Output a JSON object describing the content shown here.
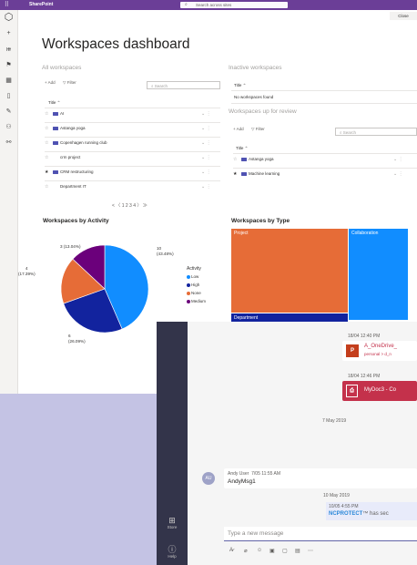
{
  "sharepoint": {
    "app_name": "SharePoint",
    "search_placeholder": "Search across sites",
    "close_label": "Close",
    "page_title": "Workspaces dashboard",
    "all_workspaces": {
      "title": "All workspaces",
      "add_label": "+ Add",
      "filter_label": "Filter",
      "search_placeholder": "Search",
      "column_title": "Title",
      "rows": [
        {
          "name": "AI",
          "starred": false,
          "icon": true
        },
        {
          "name": "Astanga yoga",
          "starred": false,
          "icon": true
        },
        {
          "name": "Copenhagen running club",
          "starred": false,
          "icon": true
        },
        {
          "name": "crm project",
          "starred": false,
          "icon": false
        },
        {
          "name": "CRM restructuring",
          "starred": true,
          "icon": true
        },
        {
          "name": "Department IT",
          "starred": false,
          "icon": false
        }
      ],
      "pager": "< 〈 1  2  3  4  〉 ≫"
    },
    "inactive_workspaces": {
      "title": "Inactive workspaces",
      "column_title": "Title",
      "empty_text": "No workspaces found"
    },
    "review_workspaces": {
      "title": "Workspaces up for review",
      "add_label": "+ Add",
      "filter_label": "Filter",
      "search_placeholder": "Search",
      "column_title": "Title",
      "rows": [
        {
          "name": "Astanga yoga",
          "starred": false
        },
        {
          "name": "Machine learning",
          "starred": true
        }
      ]
    },
    "activity_chart_title": "Workspaces by Activity",
    "type_chart_title": "Workspaces by Type",
    "legend_title": "Activity"
  },
  "chart_data": [
    {
      "type": "pie",
      "title": "Workspaces by Activity",
      "legend_title": "Activity",
      "legend_placement": "right",
      "categories": [
        "Low",
        "High",
        "None",
        "Medium"
      ],
      "values": [
        10,
        6,
        4,
        3
      ],
      "data_labels": [
        "10 (43.48%)",
        "6 (26.09%)",
        "4 (17.39%)",
        "3 (13.04%)"
      ],
      "colors": [
        "#118dff",
        "#12239e",
        "#e66c37",
        "#6b007b"
      ]
    },
    {
      "type": "heatmap",
      "title": "Workspaces by Type",
      "categories": [
        "Project",
        "Collaboration",
        "Department"
      ],
      "colors": [
        "#e66c37",
        "#118dff",
        "#12239e"
      ]
    }
  ],
  "teams": {
    "messages": [
      {
        "time": "18/04 12:40 PM",
        "file_name": "A_OneDrive_",
        "file_path": "personal > d_n",
        "file_type": "pptx",
        "color": "#c43e1c"
      },
      {
        "time": "18/04 12:46 PM",
        "file_name": "MyDoc3 - Co",
        "file_type": "pdf",
        "color": "#c4314b"
      }
    ],
    "date_divider_1": "7 May 2019",
    "user_msg": {
      "author": "Andy User",
      "time": "7/05 11:55 AM",
      "text": "AndyMsg1",
      "avatar": "AU"
    },
    "date_divider_2": "10 May 2019",
    "bot_msg": {
      "time": "10/05 4:55 PM",
      "brand": "NCPROTECT",
      "text": "has sec"
    },
    "compose_placeholder": "Type a new message",
    "rail": {
      "store_label": "Store",
      "help_label": "Help"
    }
  }
}
